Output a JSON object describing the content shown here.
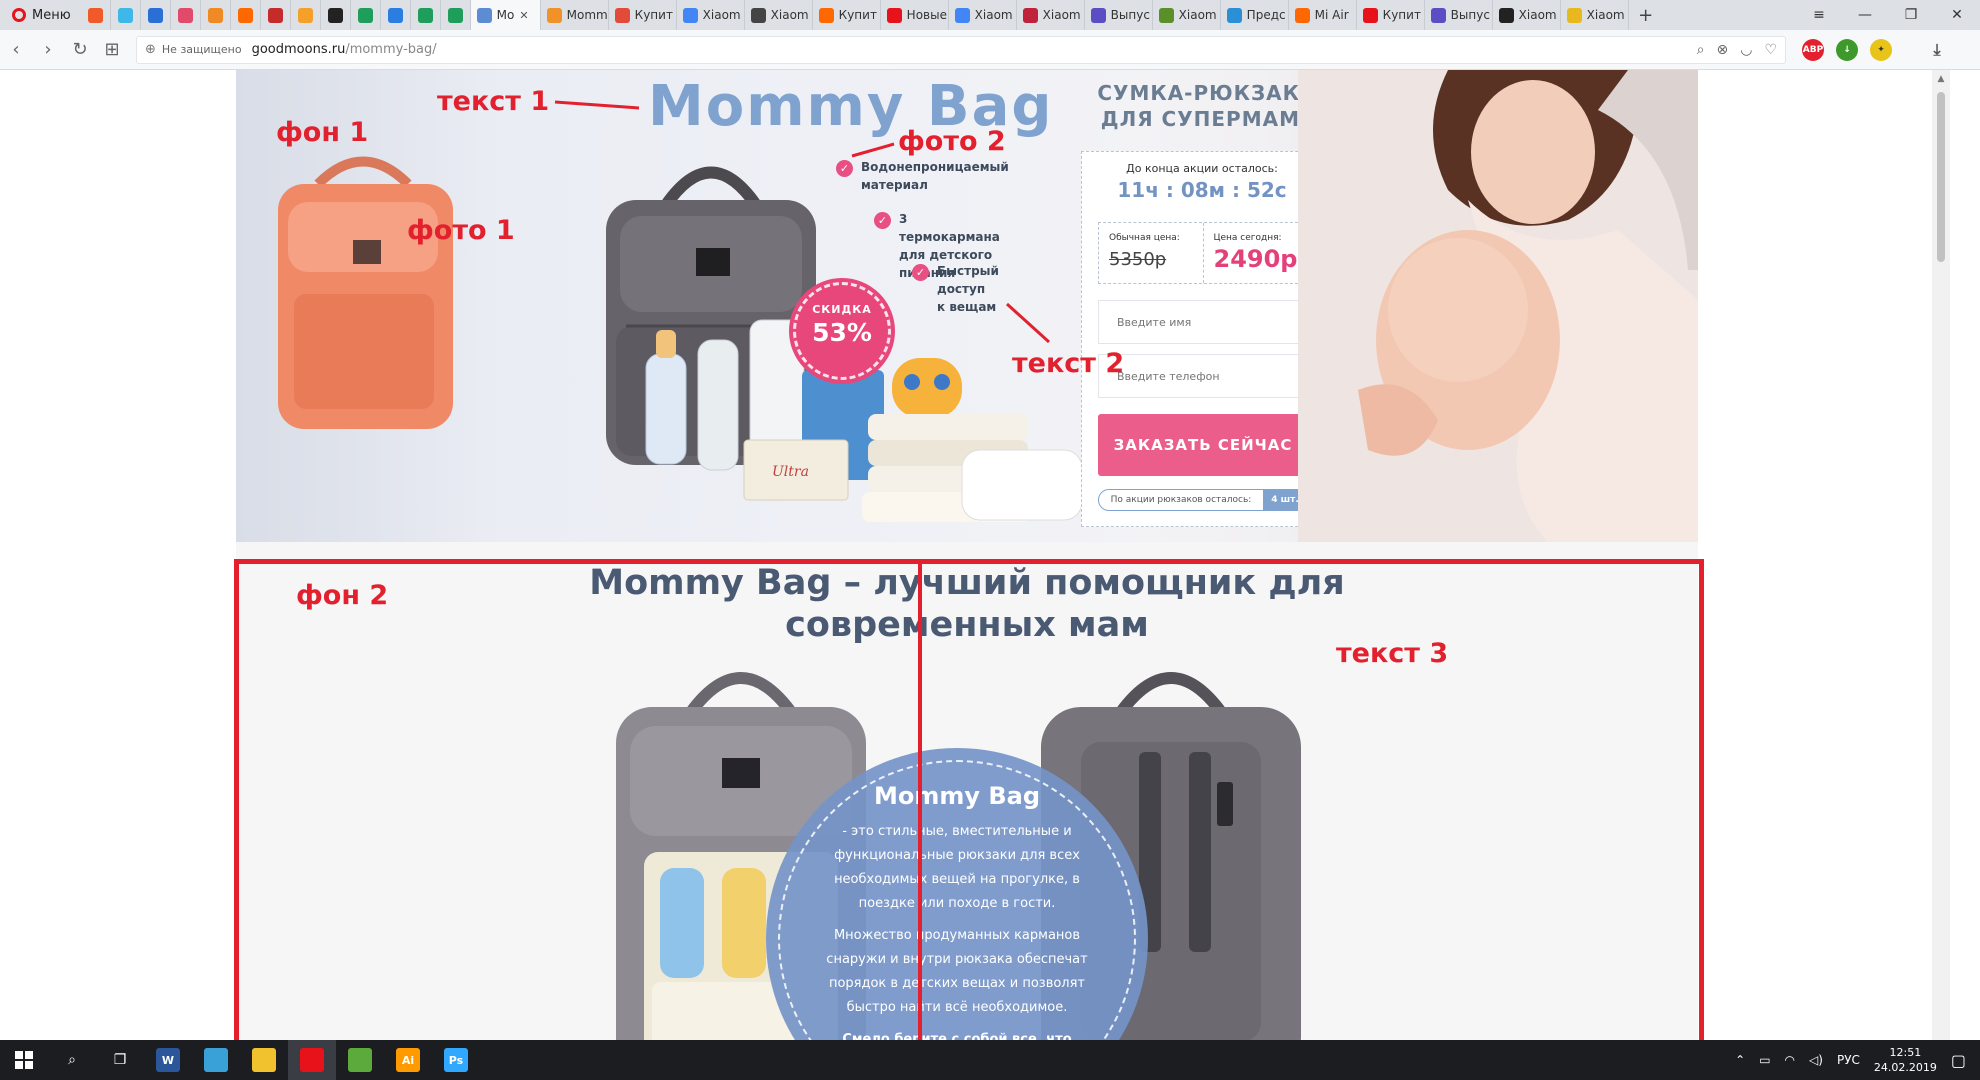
{
  "browser": {
    "menu_label": "Меню",
    "tabs": [
      {
        "label": "",
        "icon": "yandex-icon",
        "color": "#f05a28"
      },
      {
        "label": "",
        "icon": "rpo-icon",
        "color": "#3fb7e8"
      },
      {
        "label": "",
        "icon": "globe-icon",
        "color": "#2a6fd6"
      },
      {
        "label": "",
        "icon": "person-icon",
        "color": "#e24a6b"
      },
      {
        "label": "",
        "icon": "c-icon",
        "color": "#f08a24"
      },
      {
        "label": "",
        "icon": "mi-icon",
        "color": "#ff6700"
      },
      {
        "label": "",
        "icon": "flag-icon",
        "color": "#c62b2b"
      },
      {
        "label": "",
        "icon": "fox-icon",
        "color": "#f4a02a"
      },
      {
        "label": "",
        "icon": "adt-icon",
        "color": "#222222"
      },
      {
        "label": "",
        "icon": "drive-icon",
        "color": "#1e9e5a"
      },
      {
        "label": "",
        "icon": "chat-icon",
        "color": "#2a7de1"
      },
      {
        "label": "",
        "icon": "plus-icon",
        "color": "#1e9e5a"
      },
      {
        "label": "",
        "icon": "plus-icon",
        "color": "#1e9e5a"
      },
      {
        "label": "Mo",
        "icon": "moon-icon",
        "color": "#5d8bd4",
        "active": true
      },
      {
        "label": "Momm",
        "icon": "moon-icon",
        "color": "#f0912a"
      },
      {
        "label": "Купит",
        "icon": "u-icon",
        "color": "#e24a3a"
      },
      {
        "label": "Xiaom",
        "icon": "google-icon",
        "color": "#4285f4"
      },
      {
        "label": "Xiaom",
        "icon": "cat-icon",
        "color": "#444444"
      },
      {
        "label": "Купит",
        "icon": "mi-icon",
        "color": "#ff6700"
      },
      {
        "label": "Новые",
        "icon": "opera-icon",
        "color": "#e8121b"
      },
      {
        "label": "Xiaom",
        "icon": "google-icon",
        "color": "#4285f4"
      },
      {
        "label": "Xiaom",
        "icon": "shield-icon",
        "color": "#c0213b"
      },
      {
        "label": "Выпус",
        "icon": "diamond-icon",
        "color": "#5b4dc4"
      },
      {
        "label": "Xiaom",
        "icon": "leaf-icon",
        "color": "#5a8f2a"
      },
      {
        "label": "Предс",
        "icon": "cloud-icon",
        "color": "#2b8fd6"
      },
      {
        "label": "Mi Air",
        "icon": "mi-icon",
        "color": "#ff6700"
      },
      {
        "label": "Купит",
        "icon": "a-icon",
        "color": "#e8121b"
      },
      {
        "label": "Выпус",
        "icon": "diamond-icon",
        "color": "#5b4dc4"
      },
      {
        "label": "Xiaom",
        "icon": "bird-icon",
        "color": "#222222"
      },
      {
        "label": "Xiaom",
        "icon": "sun-icon",
        "color": "#e8b91e"
      }
    ],
    "security_label": "Не защищено",
    "url_host": "goodmoons.ru",
    "url_path": "/mommy-bag/"
  },
  "page": {
    "hero": {
      "title": "Mommy Bag",
      "subtitle": "СУМКА-РЮКЗАК\nДЛЯ СУПЕРМАМ",
      "features": [
        "Водонепроницаемый\nматериал",
        "3 термокармана\nдля детского питания",
        "Быстрый доступ\nк вещам"
      ],
      "discount_label": "СКИДКА",
      "discount_value": "53%"
    },
    "order_form": {
      "timer_label": "До конца акции осталось:",
      "timer_value": "11ч : 08м : 52с",
      "old_price_label": "Обычная цена:",
      "old_price": "5350р",
      "new_price_label": "Цена сегодня:",
      "new_price": "2490р",
      "name_placeholder": "Введите имя",
      "phone_placeholder": "Введите телефон",
      "submit_label": "ЗАКАЗАТЬ СЕЙЧАС",
      "stock_label": "По акции рюкзаков осталось:",
      "stock_count": "4 шт."
    },
    "section2": {
      "title": "Mommy Bag – лучший помощник для\nсовременных мам",
      "circle_title": "Mommy Bag",
      "paragraphs": [
        "- это стильные, вместительные и функциональные рюкзаки для всех необходимых вещей на прогулке, в поездке или походе в гости.",
        "Множество продуманных карманов снаружи и внутри рюкзака обеспечат порядок в детских вещах и позволят быстро найти всё необходимое."
      ],
      "closing": "Смело берите с собой все, что необходимо вам и вашему малышу!"
    }
  },
  "annotations": {
    "text1": "текст 1",
    "bg1": "фон 1",
    "photo1": "фото 1",
    "photo2": "фото 2",
    "text2": "текст 2",
    "bg2": "фон 2",
    "text3": "текст 3",
    "color": "#e2202e"
  },
  "taskbar": {
    "language": "РУС",
    "time": "12:51",
    "date": "24.02.2019",
    "apps": [
      {
        "icon": "word-icon",
        "label": "W",
        "color": "#2b579a"
      },
      {
        "icon": "camera-icon",
        "label": "",
        "color": "#3aa0d8"
      },
      {
        "icon": "folder-icon",
        "label": "",
        "color": "#f2c12e"
      },
      {
        "icon": "opera-icon",
        "label": "",
        "color": "#e8121b"
      },
      {
        "icon": "coreldraw-icon",
        "label": "",
        "color": "#5caa3c"
      },
      {
        "icon": "illustrator-icon",
        "label": "Ai",
        "color": "#ff9a00"
      },
      {
        "icon": "photoshop-icon",
        "label": "Ps",
        "color": "#31a8ff"
      }
    ]
  },
  "colors": {
    "brand_blue": "#7fa2cf",
    "accent_pink": "#e8477c",
    "heading": "#4a5a73"
  }
}
